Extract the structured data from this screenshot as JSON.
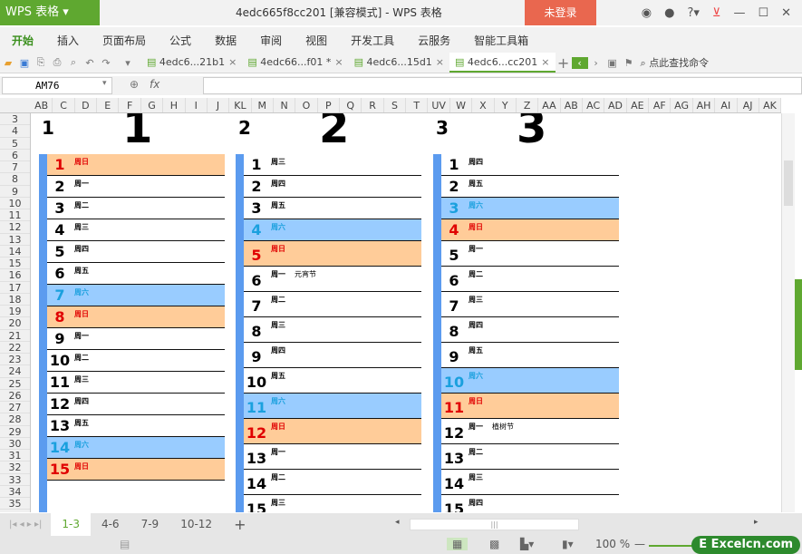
{
  "app": {
    "name": "WPS 表格",
    "title": "4edc665f8cc201 [兼容模式] - WPS 表格",
    "login": "未登录"
  },
  "menu": [
    "开始",
    "插入",
    "页面布局",
    "公式",
    "数据",
    "审阅",
    "视图",
    "开发工具",
    "云服务",
    "智能工具箱"
  ],
  "doc_tabs": [
    {
      "label": "4edc6...21b1",
      "active": false
    },
    {
      "label": "4edc66...f01 *",
      "active": false
    },
    {
      "label": "4edc6...15d1",
      "active": false
    },
    {
      "label": "4edc6...cc201",
      "active": true
    }
  ],
  "search_command": "点此查找命令",
  "formula": {
    "cell_ref": "AM76",
    "fx": "fx",
    "value": ""
  },
  "columns": [
    "AB",
    "C",
    "D",
    "E",
    "F",
    "G",
    "H",
    "I",
    "J",
    "KL",
    "M",
    "N",
    "O",
    "P",
    "Q",
    "R",
    "S",
    "T",
    "UV",
    "W",
    "X",
    "Y",
    "Z",
    "AA",
    "AB",
    "AC",
    "AD",
    "AE",
    "AF",
    "AG",
    "AH",
    "AI",
    "AJ",
    "AK"
  ],
  "rows": [
    "3",
    "4",
    "5",
    "6",
    "7",
    "8",
    "9",
    "10",
    "11",
    "12",
    "13",
    "14",
    "15",
    "16",
    "17",
    "18",
    "19",
    "20",
    "21",
    "22",
    "23",
    "24",
    "25",
    "26",
    "27",
    "28",
    "29",
    "30",
    "31",
    "32",
    "33",
    "34",
    "35"
  ],
  "months": [
    {
      "label": "1",
      "big": "1",
      "days": [
        [
          "1",
          "周日",
          ""
        ],
        [
          "2",
          "周一",
          ""
        ],
        [
          "3",
          "周二",
          ""
        ],
        [
          "4",
          "周三",
          ""
        ],
        [
          "5",
          "周四",
          ""
        ],
        [
          "6",
          "周五",
          ""
        ],
        [
          "7",
          "周六",
          ""
        ],
        [
          "8",
          "周日",
          ""
        ],
        [
          "9",
          "周一",
          ""
        ],
        [
          "10",
          "周二",
          ""
        ],
        [
          "11",
          "周三",
          ""
        ],
        [
          "12",
          "周四",
          ""
        ],
        [
          "13",
          "周五",
          ""
        ],
        [
          "14",
          "周六",
          ""
        ],
        [
          "15",
          "周日",
          ""
        ]
      ]
    },
    {
      "label": "2",
      "big": "2",
      "days": [
        [
          "1",
          "周三",
          ""
        ],
        [
          "2",
          "周四",
          ""
        ],
        [
          "3",
          "周五",
          ""
        ],
        [
          "4",
          "周六",
          ""
        ],
        [
          "5",
          "周日",
          ""
        ],
        [
          "6",
          "周一",
          "元宵节"
        ],
        [
          "7",
          "周二",
          ""
        ],
        [
          "8",
          "周三",
          ""
        ],
        [
          "9",
          "周四",
          ""
        ],
        [
          "10",
          "周五",
          ""
        ],
        [
          "11",
          "周六",
          ""
        ],
        [
          "12",
          "周日",
          ""
        ],
        [
          "13",
          "周一",
          ""
        ],
        [
          "14",
          "周二",
          ""
        ],
        [
          "15",
          "周三",
          ""
        ]
      ]
    },
    {
      "label": "3",
      "big": "3",
      "days": [
        [
          "1",
          "周四",
          ""
        ],
        [
          "2",
          "周五",
          ""
        ],
        [
          "3",
          "周六",
          ""
        ],
        [
          "4",
          "周日",
          ""
        ],
        [
          "5",
          "周一",
          ""
        ],
        [
          "6",
          "周二",
          ""
        ],
        [
          "7",
          "周三",
          ""
        ],
        [
          "8",
          "周四",
          ""
        ],
        [
          "9",
          "周五",
          ""
        ],
        [
          "10",
          "周六",
          ""
        ],
        [
          "11",
          "周日",
          ""
        ],
        [
          "12",
          "周一",
          "植树节"
        ],
        [
          "13",
          "周二",
          ""
        ],
        [
          "14",
          "周三",
          ""
        ],
        [
          "15",
          "周四",
          ""
        ]
      ]
    }
  ],
  "sheet_tabs": [
    {
      "label": "1-3",
      "active": true
    },
    {
      "label": "4-6",
      "active": false
    },
    {
      "label": "7-9",
      "active": false
    },
    {
      "label": "10-12",
      "active": false
    }
  ],
  "add_sheet": "+",
  "zoom": "100 %",
  "watermark": "Excelcn.com",
  "colors": {
    "accent": "#5fa830",
    "saturday": "#99ccff",
    "sunday": "#ffcc99",
    "bar": "#5b9bef"
  }
}
